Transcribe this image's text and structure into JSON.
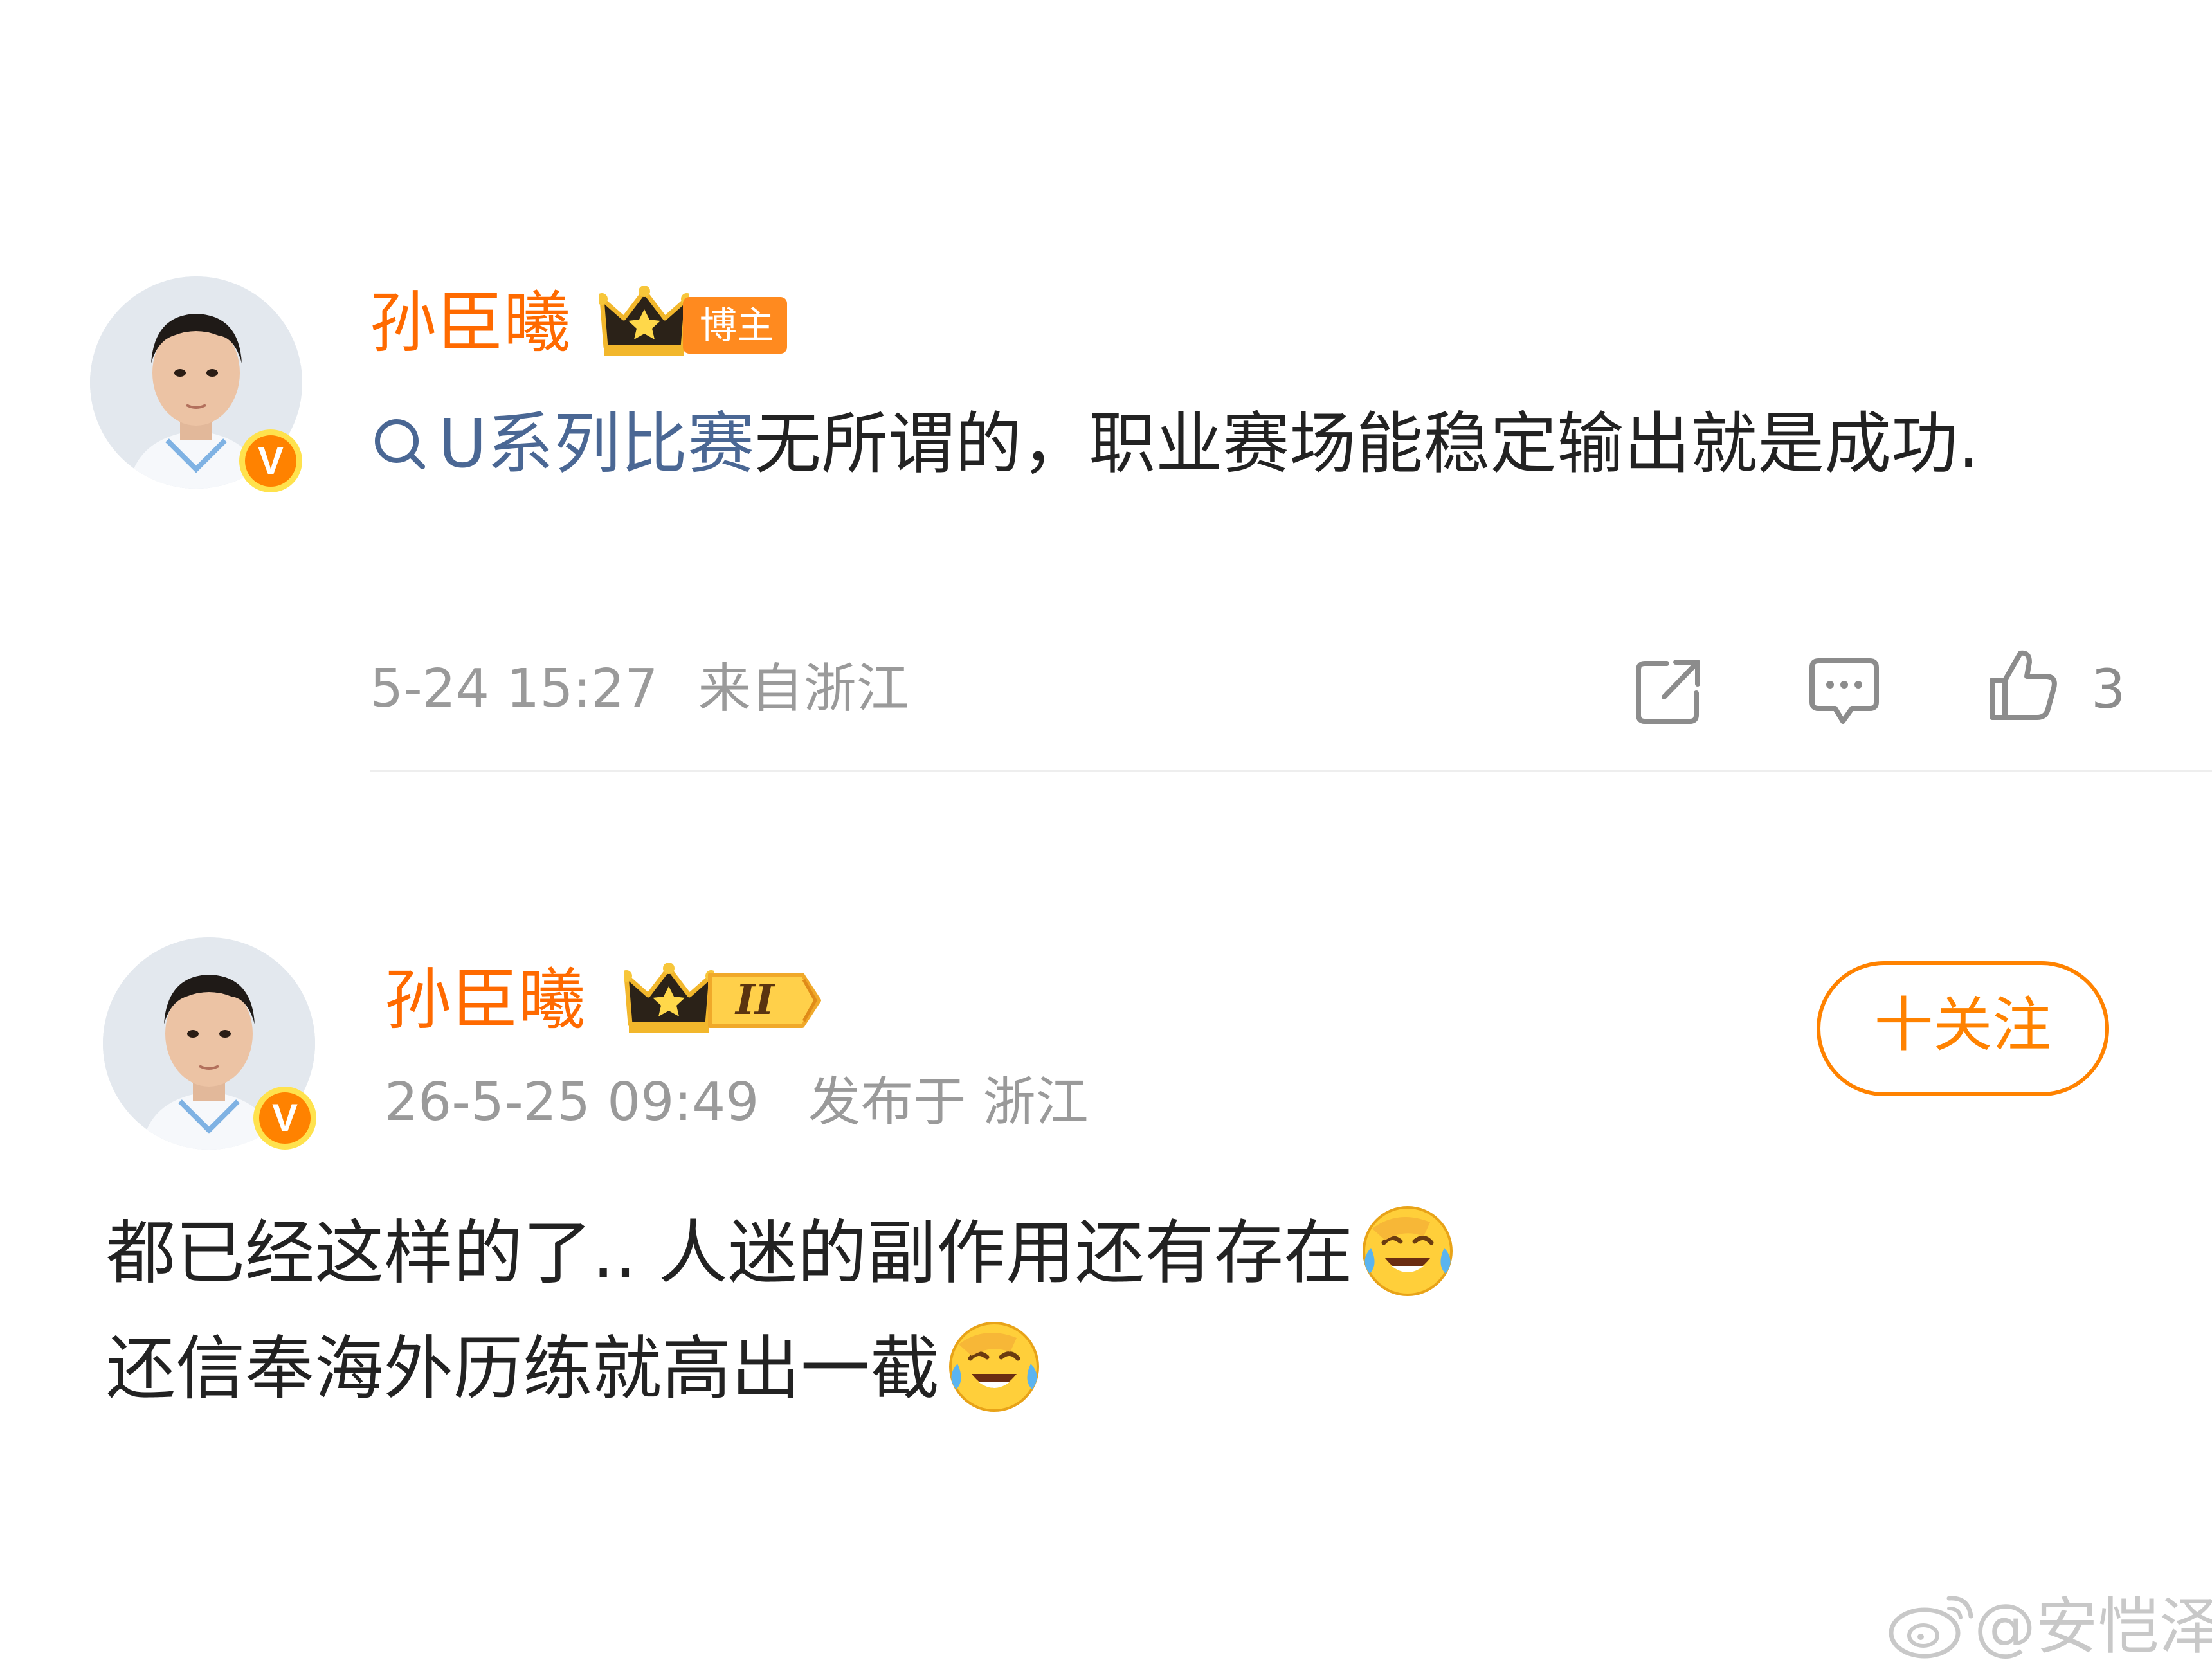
{
  "comment1": {
    "username": "孙臣曦",
    "badge_label": "博主",
    "topic_link": "U系列比赛",
    "text": "无所谓的，职业赛场能稳定输出就是成功.",
    "time": "5-24 15:27",
    "source": "来自浙江",
    "like_count": "3"
  },
  "post2": {
    "username": "孙臣曦",
    "level_label": "II",
    "time": "26-5-25 09:49",
    "source": "发布于 浙江",
    "follow_label": "十关注",
    "line1": "都已经这样的了.. 人迷的副作用还有存在",
    "line2": "还信奉海外历练就高出一截"
  },
  "watermark": "@安恺泽",
  "colors": {
    "username": "#ff6a00",
    "topic": "#4a6794",
    "meta": "#9a9a9a",
    "accent": "#ff8200"
  },
  "icons": [
    "share-icon",
    "comment-icon",
    "like-icon",
    "search-icon",
    "crown-icon",
    "verified-v-icon",
    "laughing-crying-emoji",
    "weibo-logo-icon"
  ]
}
